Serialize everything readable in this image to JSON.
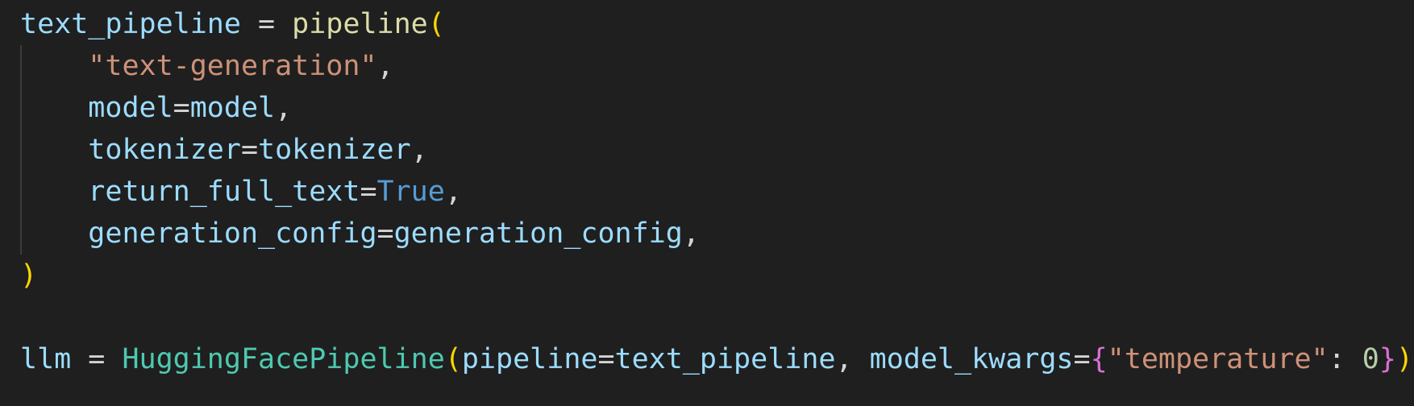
{
  "code": {
    "line1": {
      "var": "text_pipeline",
      "assign": " = ",
      "func": "pipeline",
      "paren_open": "("
    },
    "line2": {
      "indent": "    ",
      "string": "\"text-generation\"",
      "comma": ","
    },
    "line3": {
      "indent": "    ",
      "param": "model",
      "eq": "=",
      "value": "model",
      "comma": ","
    },
    "line4": {
      "indent": "    ",
      "param": "tokenizer",
      "eq": "=",
      "value": "tokenizer",
      "comma": ","
    },
    "line5": {
      "indent": "    ",
      "param": "return_full_text",
      "eq": "=",
      "value": "True",
      "comma": ","
    },
    "line6": {
      "indent": "    ",
      "param": "generation_config",
      "eq": "=",
      "value": "generation_config",
      "comma": ","
    },
    "line7": {
      "paren_close": ")"
    },
    "line9": {
      "var": "llm",
      "assign": " = ",
      "cls": "HuggingFacePipeline",
      "paren_open": "(",
      "param1": "pipeline",
      "eq1": "=",
      "value1": "text_pipeline",
      "sep": ", ",
      "param2": "model_kwargs",
      "eq2": "=",
      "brace_open": "{",
      "key": "\"temperature\"",
      "colon": ": ",
      "num": "0",
      "brace_close": "}",
      "paren_close": ")"
    }
  },
  "colors": {
    "background": "#1f1f1f",
    "variable": "#9cdcfe",
    "function": "#dcdcaa",
    "class": "#4ec9b0",
    "string": "#ce9178",
    "keyword": "#569cd6",
    "number": "#b5cea8",
    "bracket_level1": "#ffd700",
    "bracket_level2": "#da70d6"
  }
}
